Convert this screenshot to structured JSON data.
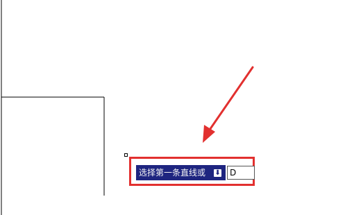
{
  "prompt": {
    "label": "选择第一条直线或",
    "dropdown_icon": "dropdown-arrow-icon",
    "input_value": "D"
  },
  "colors": {
    "prompt_background": "#1e2580",
    "highlight": "#e2302f",
    "arrow": "#e2302f"
  }
}
